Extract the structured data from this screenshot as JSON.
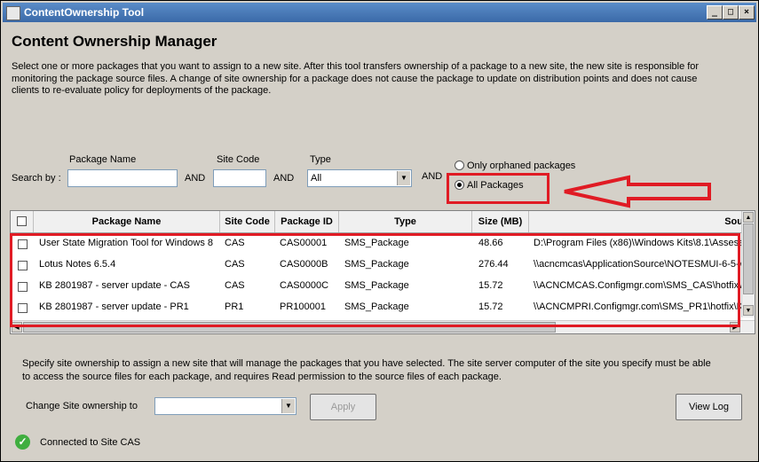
{
  "window": {
    "title": "ContentOwnership Tool"
  },
  "page": {
    "heading": "Content Ownership Manager",
    "description": "Select one or more packages that you want to assign to a new site. After this tool transfers ownership of a package to a new site, the new site is responsible for monitoring the package source files. A change of site ownership for a package does not cause the package to update on distribution points and does not cause clients to re-evaluate policy for deployments of the package."
  },
  "search": {
    "search_by_label": "Search by :",
    "package_name_label": "Package Name",
    "package_name_value": "",
    "site_code_label": "Site Code",
    "site_code_value": "",
    "type_label": "Type",
    "type_value": "All",
    "and_label": "AND",
    "only_orphaned_label": "Only orphaned packages",
    "all_packages_label": "All Packages"
  },
  "grid": {
    "columns": [
      "Package Name",
      "Site Code",
      "Package ID",
      "Type",
      "Size (MB)",
      "Sou"
    ],
    "rows": [
      {
        "name": "User State Migration Tool for Windows 8",
        "site": "CAS",
        "id": "CAS00001",
        "type": "SMS_Package",
        "size": "48.66",
        "source": "D:\\Program Files (x86)\\Windows Kits\\8.1\\Assess"
      },
      {
        "name": "Lotus Notes 6.5.4",
        "site": "CAS",
        "id": "CAS0000B",
        "type": "SMS_Package",
        "size": "276.44",
        "source": "\\\\acncmcas\\ApplicationSource\\NOTESMUI-6-5-4"
      },
      {
        "name": "KB 2801987 - server update - CAS",
        "site": "CAS",
        "id": "CAS0000C",
        "type": "SMS_Package",
        "size": "15.72",
        "source": "\\\\ACNCMCAS.Configmgr.com\\SMS_CAS\\hotfix\\K"
      },
      {
        "name": "KB 2801987 - server update - PR1",
        "site": "PR1",
        "id": "PR100001",
        "type": "SMS_Package",
        "size": "15.72",
        "source": "\\\\ACNCMPRI.Configmgr.com\\SMS_PR1\\hotfix\\KI"
      }
    ]
  },
  "ownership": {
    "description": "Specify site ownership to assign a new site that will manage the packages that you have selected. The site server computer of the site you specify must be able to access the source files for each package, and requires Read permission to the source files of each package.",
    "change_label": "Change Site ownership to",
    "change_value": "",
    "apply_label": "Apply",
    "view_log_label": "View Log"
  },
  "status": {
    "text": "Connected to Site CAS",
    "color": "#3fae3f"
  },
  "colors": {
    "highlight": "#e01b24",
    "titlebar": "#3b6aa8"
  }
}
